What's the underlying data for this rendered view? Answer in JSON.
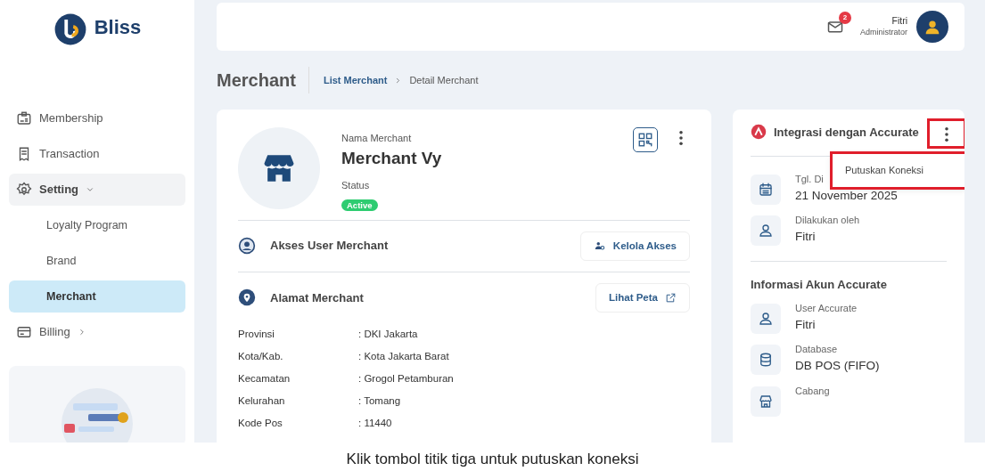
{
  "sidebar": {
    "logo": "Bliss",
    "items": [
      {
        "label": "Membership",
        "selected": false
      },
      {
        "label": "Transaction",
        "selected": false
      },
      {
        "label": "Setting",
        "selected": false,
        "expanded": true,
        "children": [
          {
            "label": "Loyalty Program",
            "selected": false
          },
          {
            "label": "Brand",
            "selected": false
          },
          {
            "label": "Merchant",
            "selected": true
          }
        ]
      },
      {
        "label": "Billing",
        "selected": false,
        "expanded": false
      }
    ]
  },
  "header": {
    "notification_count": "2",
    "user_name": "Fitri",
    "user_role": "Administrator"
  },
  "page": {
    "title": "Merchant",
    "breadcrumb": [
      {
        "label": "List Merchant"
      },
      {
        "label": "Detail Merchant"
      }
    ]
  },
  "merchant_card": {
    "name_label": "Nama Merchant",
    "name": "Merchant Vy",
    "status_label": "Status",
    "status": "Active",
    "sections": [
      {
        "title": "Akses User Merchant",
        "button": "Kelola Akses"
      },
      {
        "title": "Alamat Merchant",
        "button": "Lihat Peta"
      }
    ],
    "address": [
      {
        "label": "Provinsi",
        "value": ": DKI Jakarta"
      },
      {
        "label": "Kota/Kab.",
        "value": ": Kota Jakarta Barat"
      },
      {
        "label": "Kecamatan",
        "value": ": Grogol Petamburan"
      },
      {
        "label": "Kelurahan",
        "value": ": Tomang"
      },
      {
        "label": "Kode Pos",
        "value": ": 11440"
      }
    ]
  },
  "integration_card": {
    "title": "Integrasi dengan Accurate",
    "menu": {
      "highlighted": true,
      "items": [
        {
          "label": "Putuskan Koneksi",
          "highlighted": true
        }
      ]
    },
    "fields": [
      {
        "label": "Tgl. Di",
        "value": "21 November 2025"
      },
      {
        "label": "Dilakukan oleh",
        "value": "Fitri"
      }
    ],
    "account_title": "Informasi Akun Accurate",
    "account_fields": [
      {
        "label": "User Accurate",
        "value": "Fitri"
      },
      {
        "label": "Database",
        "value": "DB POS (FIFO)"
      },
      {
        "label": "Cabang"
      }
    ]
  },
  "caption": "Klik tombol titik tiga untuk putuskan koneksi"
}
